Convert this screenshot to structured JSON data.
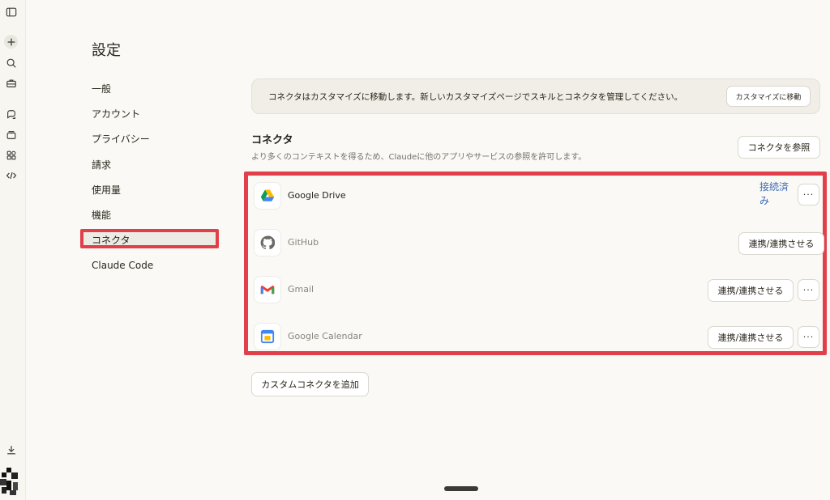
{
  "settings": {
    "title": "設定",
    "nav": [
      {
        "label": "一般"
      },
      {
        "label": "アカウント"
      },
      {
        "label": "プライバシー"
      },
      {
        "label": "請求"
      },
      {
        "label": "使用量"
      },
      {
        "label": "機能"
      },
      {
        "label": "コネクタ",
        "active": true
      },
      {
        "label": "Claude Code"
      }
    ]
  },
  "notice": {
    "text": "コネクタはカスタマイズに移動します。新しいカスタマイズページでスキルとコネクタを管理してください。",
    "button_label": "カスタマイズに移動"
  },
  "connectors": {
    "title": "コネクタ",
    "subtitle": "より多くのコンテキストを得るため、Claudeに他のアプリやサービスの参照を許可します。",
    "browse_label": "コネクタを参照",
    "items": [
      {
        "name": "Google Drive",
        "icon": "google-drive-icon",
        "status": "接続済み",
        "more": "···"
      },
      {
        "name": "GitHub",
        "icon": "github-icon",
        "action": "連携/連携させる"
      },
      {
        "name": "Gmail",
        "icon": "gmail-icon",
        "action": "連携/連携させる",
        "more": "···"
      },
      {
        "name": "Google Calendar",
        "icon": "google-calendar-icon",
        "action": "連携/連携させる",
        "more": "···"
      }
    ],
    "add_custom_label": "カスタムコネクタを追加"
  },
  "colors": {
    "accent_highlight": "#e0404a",
    "connected_text": "#3c6ab8",
    "background": "#faf9f5"
  }
}
